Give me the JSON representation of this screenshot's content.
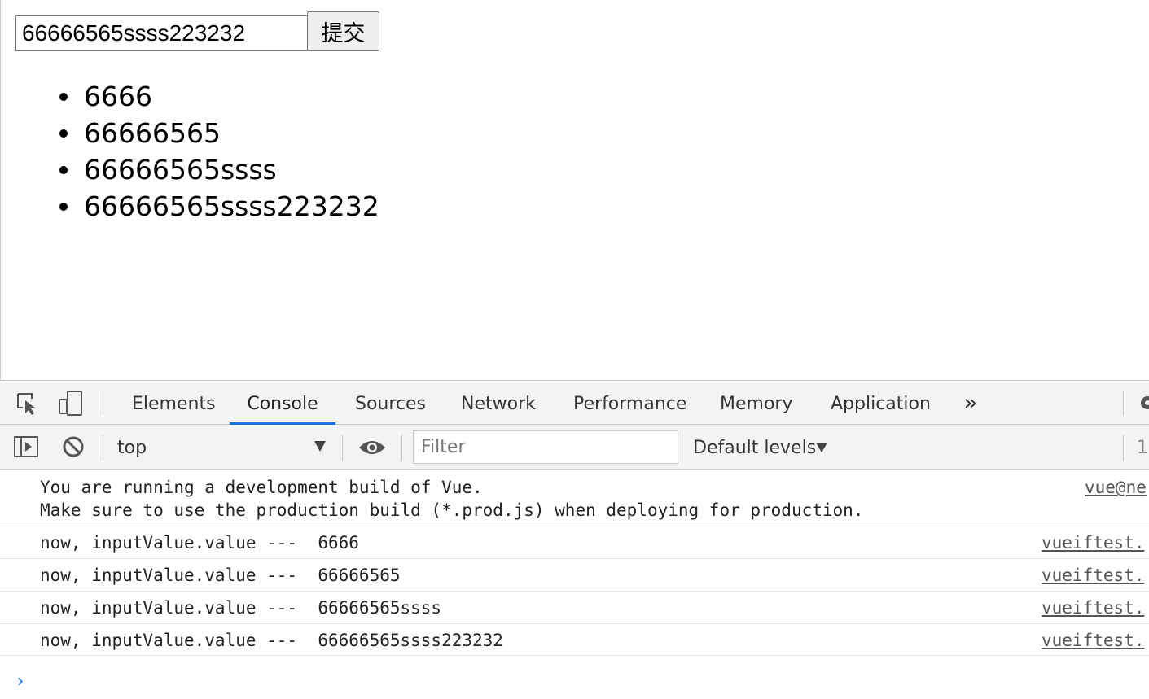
{
  "page": {
    "input_value": "66666565ssss223232",
    "submit_label": "提交",
    "items": [
      "6666",
      "66666565",
      "66666565ssss",
      "66666565ssss223232"
    ]
  },
  "devtools": {
    "tabs": [
      "Elements",
      "Console",
      "Sources",
      "Network",
      "Performance",
      "Memory",
      "Application"
    ],
    "active_tab": "Console",
    "more_tabs_label": "»",
    "context": "top",
    "filter_placeholder": "Filter",
    "levels_label": "Default levels",
    "issue_count": "1",
    "accent_color": "#1a73e8",
    "messages": [
      {
        "line1": "You are running a development build of Vue.",
        "line2": "Make sure to use the production build (*.prod.js) when deploying for production.",
        "source": "vue@ne"
      },
      {
        "line1": "now, inputValue.value ---  6666",
        "source": "vueiftest."
      },
      {
        "line1": "now, inputValue.value ---  66666565",
        "source": "vueiftest."
      },
      {
        "line1": "now, inputValue.value ---  66666565ssss",
        "source": "vueiftest."
      },
      {
        "line1": "now, inputValue.value ---  66666565ssss223232",
        "source": "vueiftest."
      }
    ],
    "prompt_symbol": "›"
  }
}
